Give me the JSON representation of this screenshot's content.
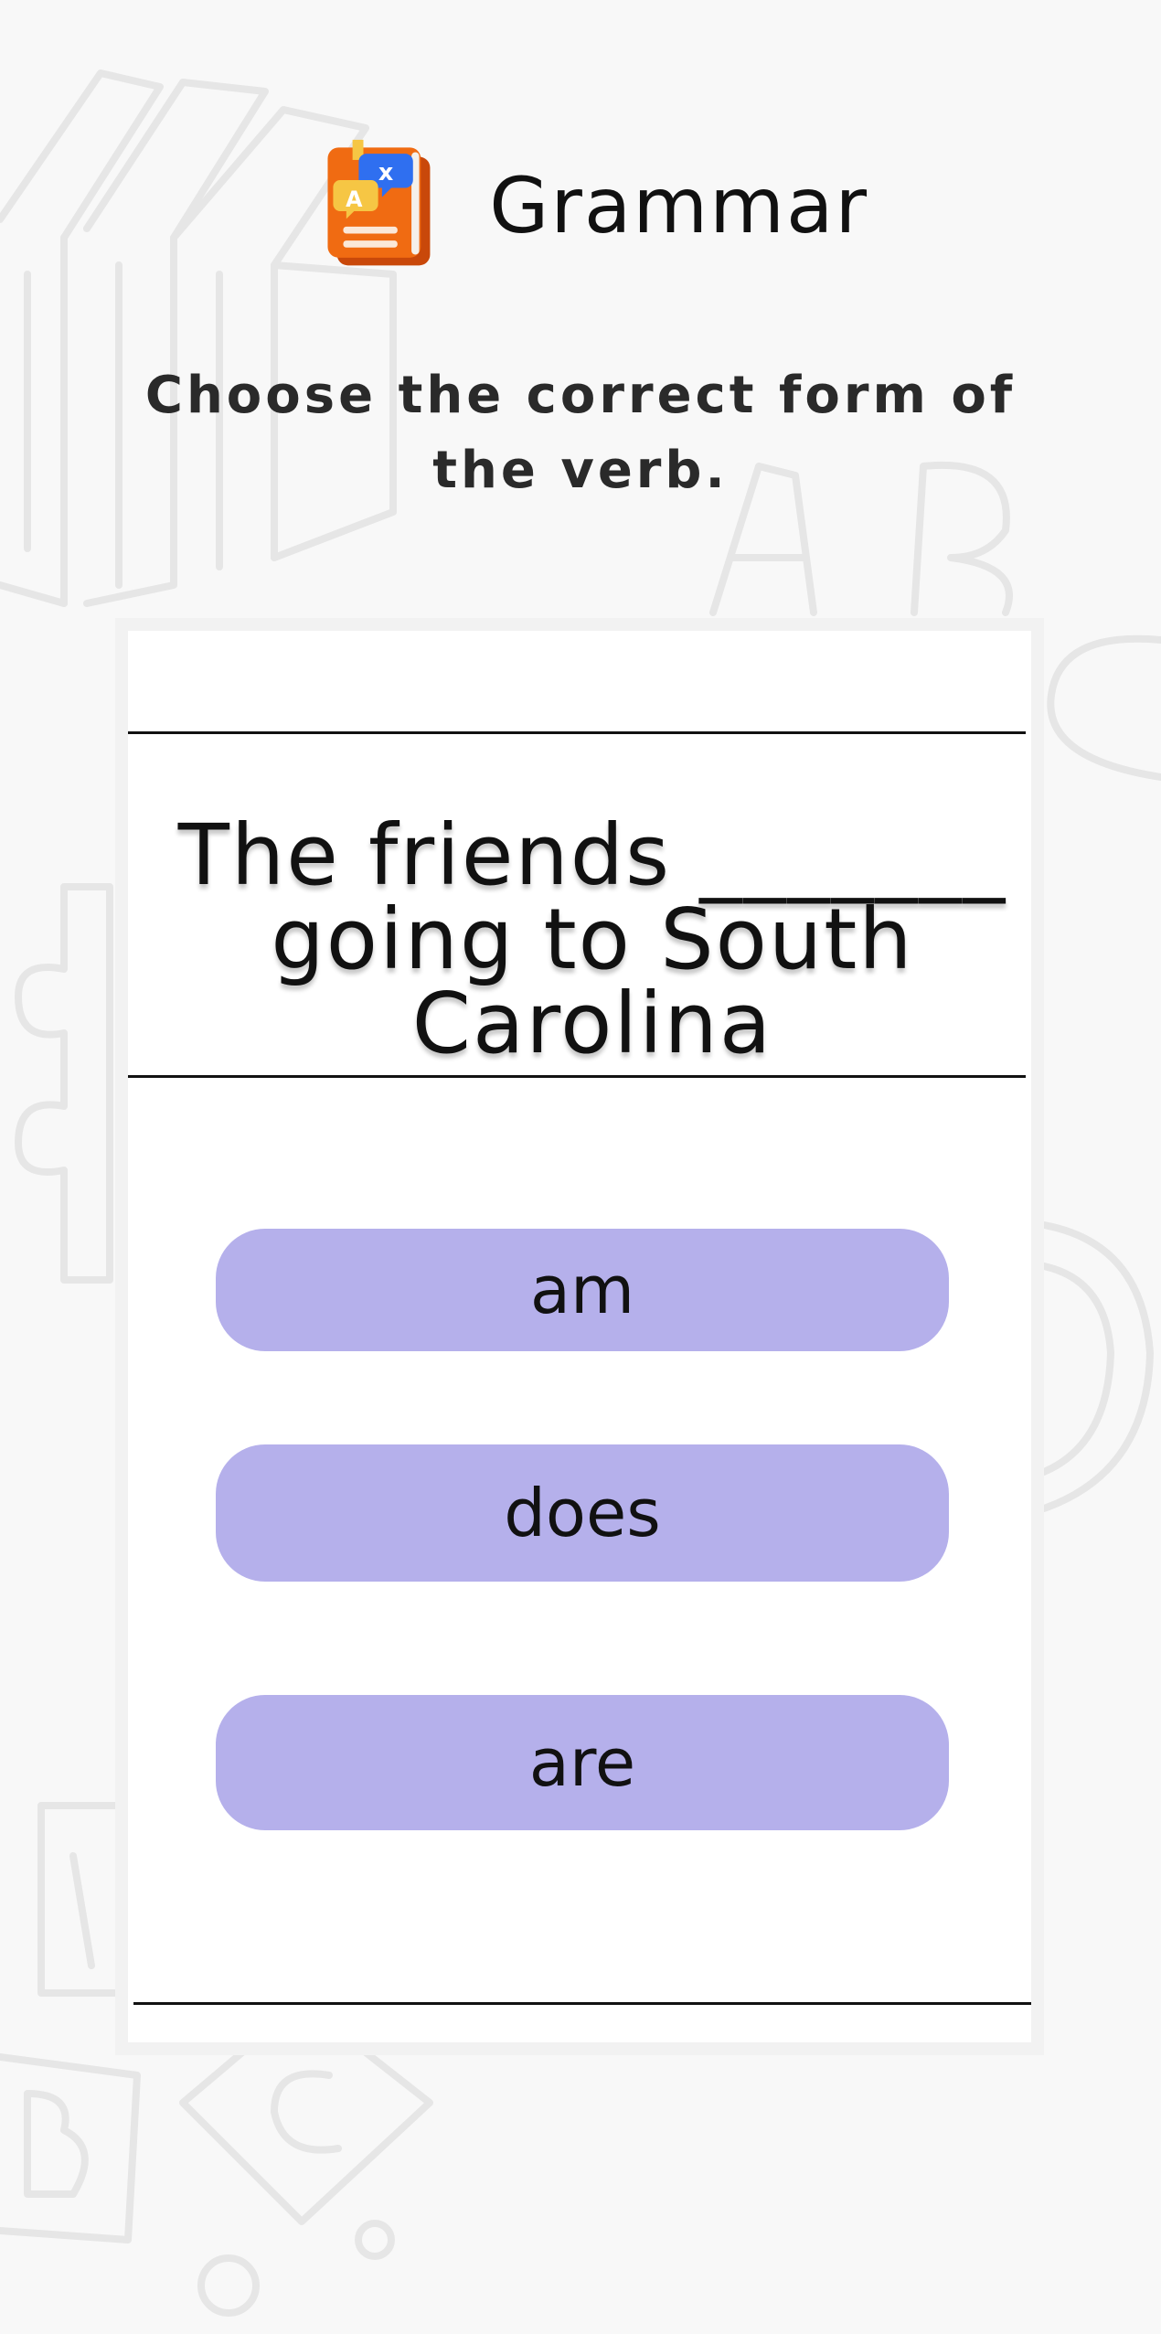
{
  "header": {
    "title": "Grammar",
    "icon": "translate-book-icon"
  },
  "instruction": "Choose the correct form of the verb.",
  "question": {
    "line1": "The friends _______",
    "line2": "going to South",
    "line3": "Carolina"
  },
  "options": [
    {
      "label": "am"
    },
    {
      "label": "does"
    },
    {
      "label": "are"
    }
  ],
  "colors": {
    "background": "#f8f8f8",
    "card": "#ffffff",
    "option": "#b5b0eb",
    "text": "#111111",
    "icon_book": "#f06b12",
    "icon_bubble_blue": "#2f6ff0",
    "icon_bubble_yellow": "#f6c644"
  }
}
